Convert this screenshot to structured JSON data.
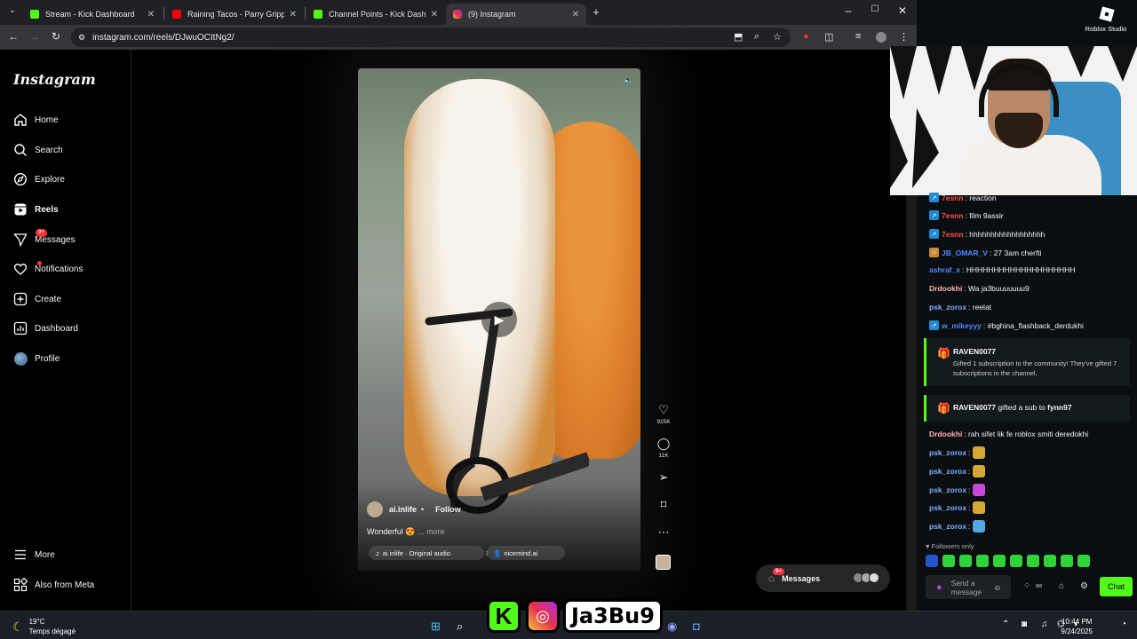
{
  "browser": {
    "tabs": [
      {
        "title": "Stream - Kick Dashboard",
        "favicon_color": "#53fc18"
      },
      {
        "title": "Raining Tacos - Parry Gripp & B",
        "favicon_color": "#ff0000"
      },
      {
        "title": "Channel Points - Kick Dashboard",
        "favicon_color": "#53fc18"
      },
      {
        "title": "(9) Instagram",
        "favicon_color": "#e1306c",
        "active": true
      }
    ],
    "url": "instagram.com/reels/DJwuOCItNg2/"
  },
  "instagram": {
    "logo": "Instagram",
    "nav": [
      {
        "label": "Home",
        "icon": "home-icon"
      },
      {
        "label": "Search",
        "icon": "search-icon"
      },
      {
        "label": "Explore",
        "icon": "compass-icon"
      },
      {
        "label": "Reels",
        "icon": "reels-icon"
      },
      {
        "label": "Messages",
        "icon": "send-icon",
        "badge": "9+"
      },
      {
        "label": "Notifications",
        "icon": "heart-icon"
      },
      {
        "label": "Create",
        "icon": "plus-square-icon"
      },
      {
        "label": "Dashboard",
        "icon": "bar-chart-icon"
      },
      {
        "label": "Profile",
        "icon": "avatar-icon"
      }
    ],
    "bottom_nav": [
      {
        "label": "More",
        "icon": "menu-icon"
      },
      {
        "label": "Also from Meta",
        "icon": "meta-icon"
      }
    ],
    "reel": {
      "author": "ai.inlife",
      "follow": "Follow",
      "caption": "Wonderful 😍",
      "more": "... more",
      "audio": "ai.inlife · Original audio",
      "tag": "nicemind.ai",
      "likes": "925K",
      "comments": "11K"
    },
    "messages_pill": {
      "label": "Messages",
      "badge": "9+"
    }
  },
  "stream": {
    "roblox_label": "Roblox Studio",
    "chat": [
      {
        "user": "7esnn",
        "text": ": reaction",
        "color": "#ff4e4e",
        "badge": true
      },
      {
        "user": "7esnn",
        "text": ": film 9assir",
        "color": "#ff4e4e",
        "badge": true
      },
      {
        "user": "7esnn",
        "text": ": hhhhhhhhhhhhhhhhhh",
        "color": "#ff4e4e",
        "badge": true
      },
      {
        "user": "JB_OMAR_V",
        "text": ": 27 3am cherfti",
        "color": "#4e8cff",
        "badge": true
      },
      {
        "user": "ashraf_x",
        "text": ": HHHHHHHHHHHHHHHHHHHH",
        "color": "#4e8cff",
        "badge": false
      },
      {
        "user": "Drdookhi",
        "text": ": Wa ja3buuuuuuu9",
        "color": "#ffb3b3",
        "badge": false
      },
      {
        "user": "psk_zorox",
        "text": ": reelat",
        "color": "#7fb0ff",
        "badge": false
      },
      {
        "user": "w_mikeyyy",
        "text": ": #bghina_flashback_derdukhi",
        "color": "#4e8cff",
        "badge": true
      }
    ],
    "sub1": {
      "user": "RAVEN0077",
      "text": "Gifted 1 subscription to the community! They've gifted 7 subscriptions in the channel."
    },
    "sub2": {
      "user": "RAVEN0077",
      "mid": " gifted a sub to ",
      "target": "fynn97"
    },
    "chat2": [
      {
        "user": "Drdookhi",
        "text": ": rah sifet lik fe roblox smiti deredokhi",
        "color": "#ffb3b3"
      },
      {
        "user": "psk_zorox",
        "text": ":",
        "color": "#7fb0ff",
        "emote": "#d4a835"
      },
      {
        "user": "psk_zorox",
        "text": ":",
        "color": "#7fb0ff",
        "emote": "#d4a835"
      },
      {
        "user": "psk_zorox",
        "text": ":",
        "color": "#7fb0ff",
        "emote": "#c34ad8"
      },
      {
        "user": "psk_zorox",
        "text": ":",
        "color": "#7fb0ff",
        "emote": "#d4a835"
      },
      {
        "user": "psk_zorox",
        "text": ":",
        "color": "#7fb0ff",
        "emote": "#52a8e0"
      }
    ],
    "followers_only": "Followers only",
    "send_placeholder": "Send a message",
    "chat_button": "Chat"
  },
  "taskbar": {
    "temp": "19°C",
    "weather": "Temps dégagé",
    "overlay_text": "Ja3Bu9",
    "time": "10:44 PM",
    "date": "9/24/2025"
  }
}
